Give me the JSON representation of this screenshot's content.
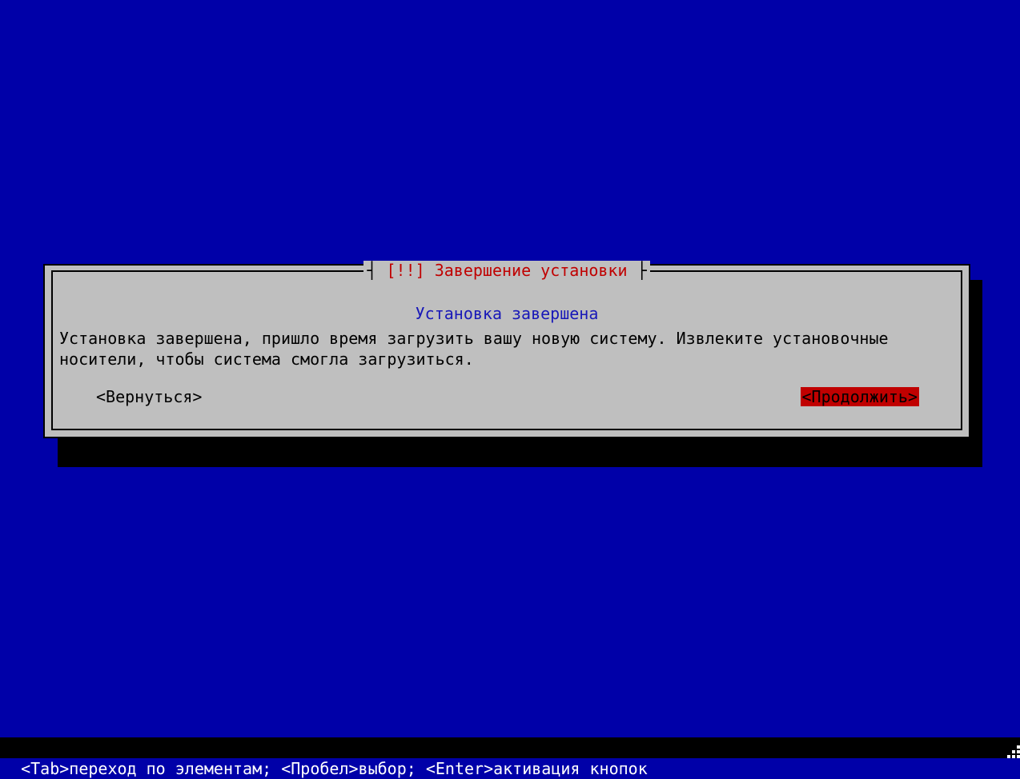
{
  "dialog": {
    "title_prefix": "┤ ",
    "title_marker": "[!!]",
    "title_text": " Завершение установки ",
    "title_suffix": "├",
    "subtitle": "Установка завершена",
    "body": "Установка завершена, пришло время загрузить вашу новую систему. Извлеките установочные носители, чтобы система смогла загрузиться.",
    "back_label": "<Вернуться>",
    "continue_label": "<Продолжить>"
  },
  "footer": {
    "text": "<Tab>переход по элементам; <Пробел>выбор; <Enter>активация кнопок"
  }
}
